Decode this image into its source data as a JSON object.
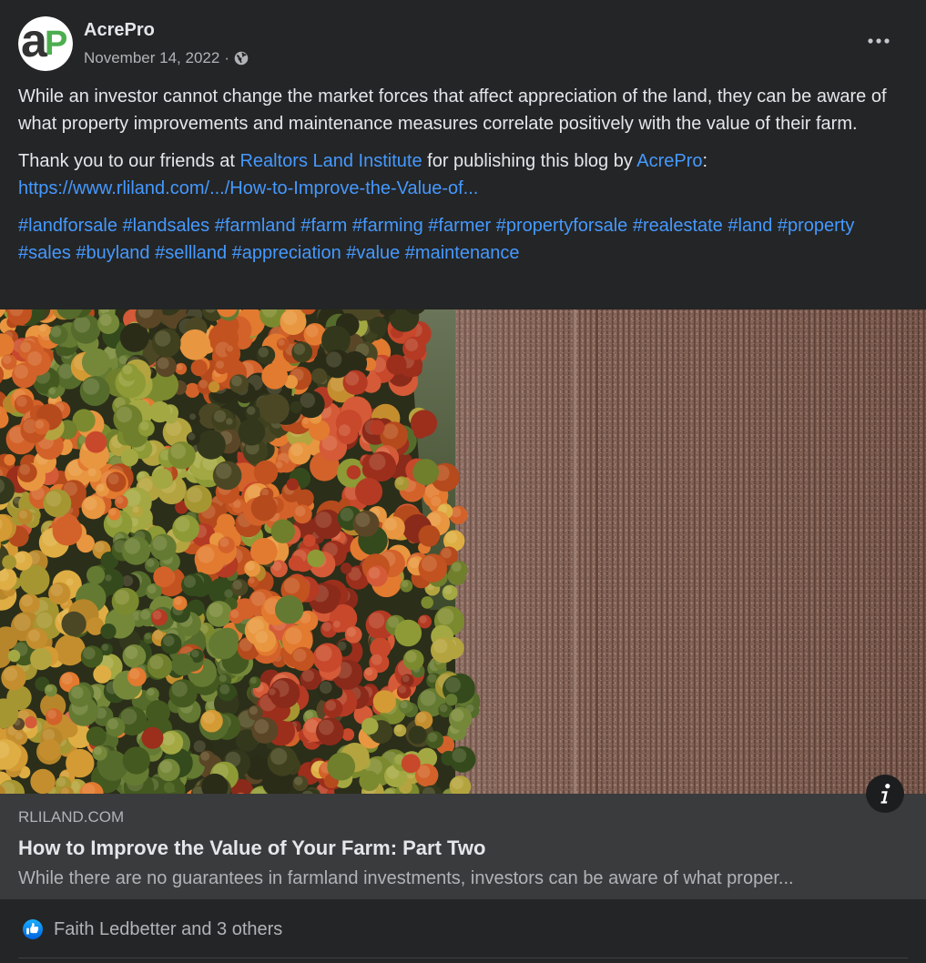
{
  "colors": {
    "background": "#242526",
    "text_primary": "#e4e6eb",
    "text_secondary": "#b0b3b8",
    "link": "#4599ff",
    "preview_background": "#3a3b3c",
    "divider": "#3e4042",
    "logo_dark": "#333333",
    "logo_green": "#4cae4f",
    "like_blue": "#1877f2"
  },
  "post": {
    "author": "AcrePro",
    "avatar": {
      "icon": "acrepro-logo",
      "logo_a": "a",
      "logo_p": "P"
    },
    "date": "November 14, 2022",
    "separator": "·",
    "audience_icon": "globe-icon",
    "more_icon": "more-horizontal-icon"
  },
  "body": {
    "paragraph1": "While an investor cannot change the market forces that affect appreciation of the land, they can be aware of what property improvements and maintenance measures correlate positively with the value of their farm.",
    "thanks": {
      "prefix": "Thank you to our friends at ",
      "link_institute": "Realtors Land Institute",
      "middle": " for publishing this blog by ",
      "link_author": "AcrePro",
      "suffix": ":",
      "url": "https://www.rliland.com/.../How-to-Improve-the-Value-of..."
    },
    "hashtags": [
      "#landforsale",
      "#landsales",
      "#farmland",
      "#farm",
      "#farming",
      "#farmer",
      "#propertyforsale",
      "#realestate",
      "#land",
      "#property",
      "#sales",
      "#buyland",
      "#sellland",
      "#appreciation",
      "#value",
      "#maintenance"
    ]
  },
  "link_preview": {
    "info_icon": "info-icon",
    "domain": "RLILAND.COM",
    "title": "How to Improve the Value of Your Farm: Part Two",
    "description": "While there are no guarantees in farmland investments, investors can be aware of what proper..."
  },
  "reactions": {
    "icon": "like-icon",
    "summary": "Faith Ledbetter and 3 others"
  }
}
